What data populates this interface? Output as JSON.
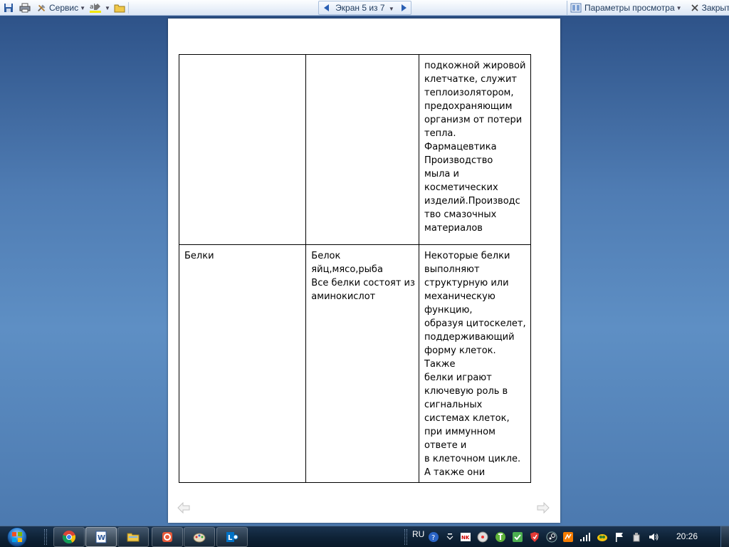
{
  "toolbar": {
    "service_label": "Сервис",
    "nav_label": "Экран 5 из 7",
    "view_params_label": "Параметры просмотра",
    "close_label": "Закрыть"
  },
  "document": {
    "rows": [
      {
        "col1": "",
        "col2": "",
        "col3": "подкожной жировой\nклетчатке, служит\nтеплоизолятором,\nпредохраняющим\nорганизм от потери\nтепла.\nФармацевтика\nПроизводство\nмыла и\nкосметических\nизделий.Производс\nтво смазочных\nматериалов"
      },
      {
        "col1": "Белки",
        "col2": "Белок\nяйц,мясо,рыба\nВсе белки состоят из\nаминокислот",
        "col3": " Некоторые белки\nвыполняют\nструктурную или\nмеханическую\nфункцию,\nобразуя цитоскелет,\nподдерживающий\nформу клеток. Также\nбелки играют\nключевую роль в\n сигнальных\nсистемах клеток,\nпри иммунном\nответе и\nв клеточном  цикле.\nА также они"
      }
    ]
  },
  "taskbar": {
    "language": "RU",
    "clock": "20:26",
    "apps": [
      "chrome-icon",
      "word-icon",
      "explorer-icon",
      "app-icon",
      "paint-icon",
      "lync-icon"
    ]
  }
}
